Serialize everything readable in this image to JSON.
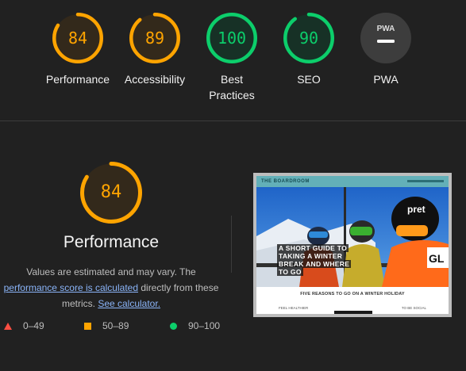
{
  "summary_gauges": [
    {
      "label": "Performance",
      "score": "84",
      "score_fraction": 0.84,
      "color": "#ffa400",
      "bg": "#33291b"
    },
    {
      "label": "Accessibility",
      "score": "89",
      "score_fraction": 0.89,
      "color": "#ffa400",
      "bg": "#33291b"
    },
    {
      "label": "Best Practices",
      "score": "100",
      "score_fraction": 1.0,
      "color": "#0cce6b",
      "bg": "#173126"
    },
    {
      "label": "SEO",
      "score": "90",
      "score_fraction": 0.9,
      "color": "#0cce6b",
      "bg": "#173126"
    },
    {
      "label": "PWA",
      "badge": "PWA",
      "icon": "pwa-icon",
      "color": "#ffffff",
      "bg": "#3d3d3d"
    }
  ],
  "performance_section": {
    "score": "84",
    "score_fraction": 0.84,
    "title": "Performance",
    "desc_before": "Values are estimated and may vary. The ",
    "link_score_calc": "performance score is calculated",
    "desc_middle": " directly from these metrics. ",
    "link_calculator": "See calculator.",
    "accent": "#ffa400"
  },
  "legend": [
    {
      "label": "0–49",
      "icon": "red-triangle-icon",
      "color": "#ff4e42"
    },
    {
      "label": "50–89",
      "icon": "orange-square-icon",
      "color": "#ffa400"
    },
    {
      "label": "90–100",
      "icon": "green-circle-icon",
      "color": "#0cce6b"
    }
  ],
  "screenshot": {
    "brand": "THE BOARDROOM",
    "hero_lines": [
      "A SHORT GUIDE TO",
      "TAKING A WINTER",
      "BREAK AND WHERE",
      "TO GO"
    ],
    "subtitle": "FIVE REASONS TO GO ON A WINTER HOLIDAY",
    "footer_left": "FEEL HEALTHIER",
    "footer_right": "TO BE SOCIAL"
  }
}
